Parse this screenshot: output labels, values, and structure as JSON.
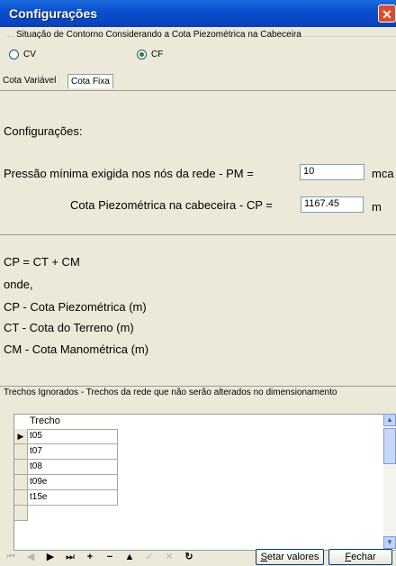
{
  "window": {
    "title": "Configurações",
    "close_glyph": "✕"
  },
  "group": {
    "legend": "Situação de Contorno Considerando a Cota Piezométrica na Cabeceira",
    "options": [
      {
        "label": "CV",
        "selected": false
      },
      {
        "label": "CF",
        "selected": true
      }
    ]
  },
  "tabs": [
    {
      "label": "Cota Variável",
      "active": false
    },
    {
      "label": "Cota Fixa",
      "active": true
    }
  ],
  "main": {
    "heading": "Configurações:",
    "pm_label": "Pressão mínima exigida nos nós da rede - PM =",
    "pm_value": "10",
    "pm_unit": "mca",
    "cp_label": "Cota Piezométrica na cabeceira - CP =",
    "cp_value": "1167.45",
    "cp_unit": "m",
    "formula": "CP = CT + CM",
    "where": "onde,",
    "defs": [
      "CP - Cota Piezométrica (m)",
      "CT - Cota do Terreno (m)",
      "CM - Cota Manométrica (m)"
    ]
  },
  "ignored": {
    "label": "Trechos Ignorados - Trechos da rede que não serão alterados no dimensionamento",
    "column": "Trecho",
    "rows": [
      "t05",
      "t07",
      "t08",
      "t09e",
      "t15e"
    ]
  },
  "toolbar": {
    "set_values": "Setar valores",
    "close": "Fechar"
  }
}
